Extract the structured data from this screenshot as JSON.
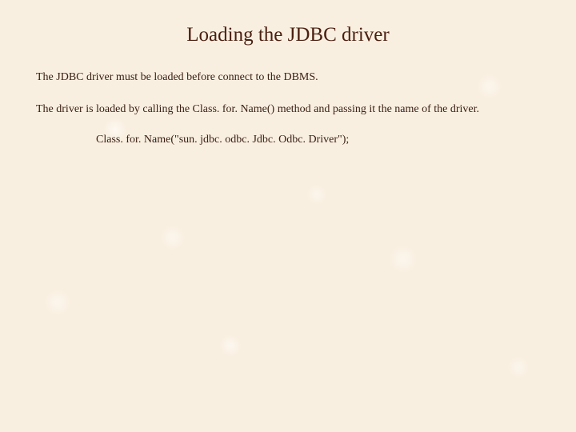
{
  "slide": {
    "title": "Loading the JDBC driver",
    "paragraph1": "The JDBC driver must be loaded before connect to the DBMS.",
    "paragraph2": "The driver is loaded by calling the Class. for. Name() method and passing it the name of the driver.",
    "code": "Class. for. Name(\"sun. jdbc. odbc. Jdbc. Odbc. Driver\");"
  }
}
